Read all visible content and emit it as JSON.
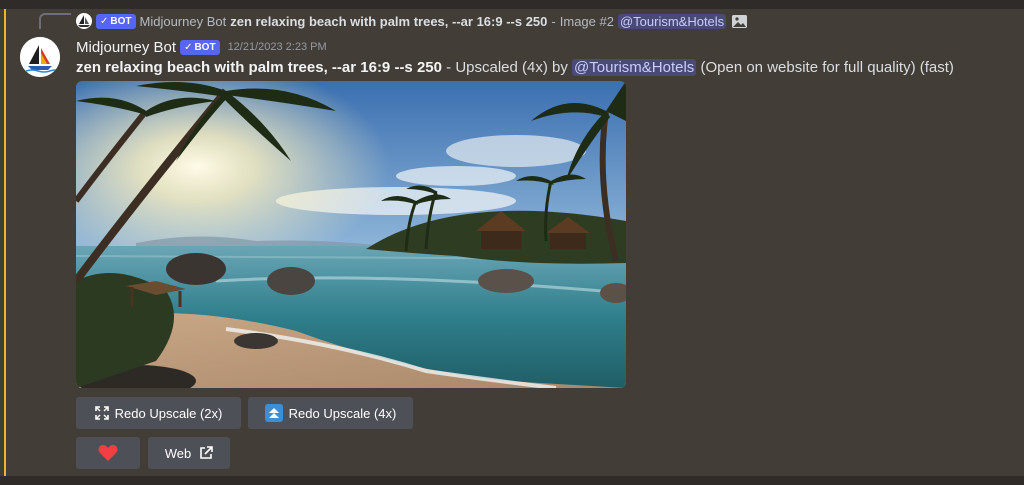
{
  "reply": {
    "author": "Midjourney Bot",
    "bot_tag": "BOT",
    "prompt": "zen relaxing beach with palm trees, --ar 16:9 --s 250",
    "separator": "-",
    "image_label": "Image #2",
    "mention": "@Tourism&Hotels"
  },
  "message": {
    "author": "Midjourney Bot",
    "bot_tag": "BOT",
    "timestamp": "12/21/2023 2:23 PM",
    "prompt": "zen relaxing beach with palm trees, --ar 16:9 --s 250",
    "status_prefix": "- Upscaled (4x) by",
    "mention": "@Tourism&Hotels",
    "status_suffix": "(Open on website for full quality) (fast)"
  },
  "buttons": {
    "redo_2x": "Redo Upscale (2x)",
    "redo_4x": "Redo Upscale (4x)",
    "web": "Web"
  },
  "icons": {
    "heart": "heart-icon",
    "external": "external-link-icon",
    "expand": "expand-icon",
    "upscale": "upscale-arrows-icon",
    "image": "image-icon"
  },
  "colors": {
    "mention_bar": "#f0b232",
    "bot_tag": "#5865f2",
    "heart": "#f23f43",
    "upscale_icon": "#3b8fd6"
  }
}
